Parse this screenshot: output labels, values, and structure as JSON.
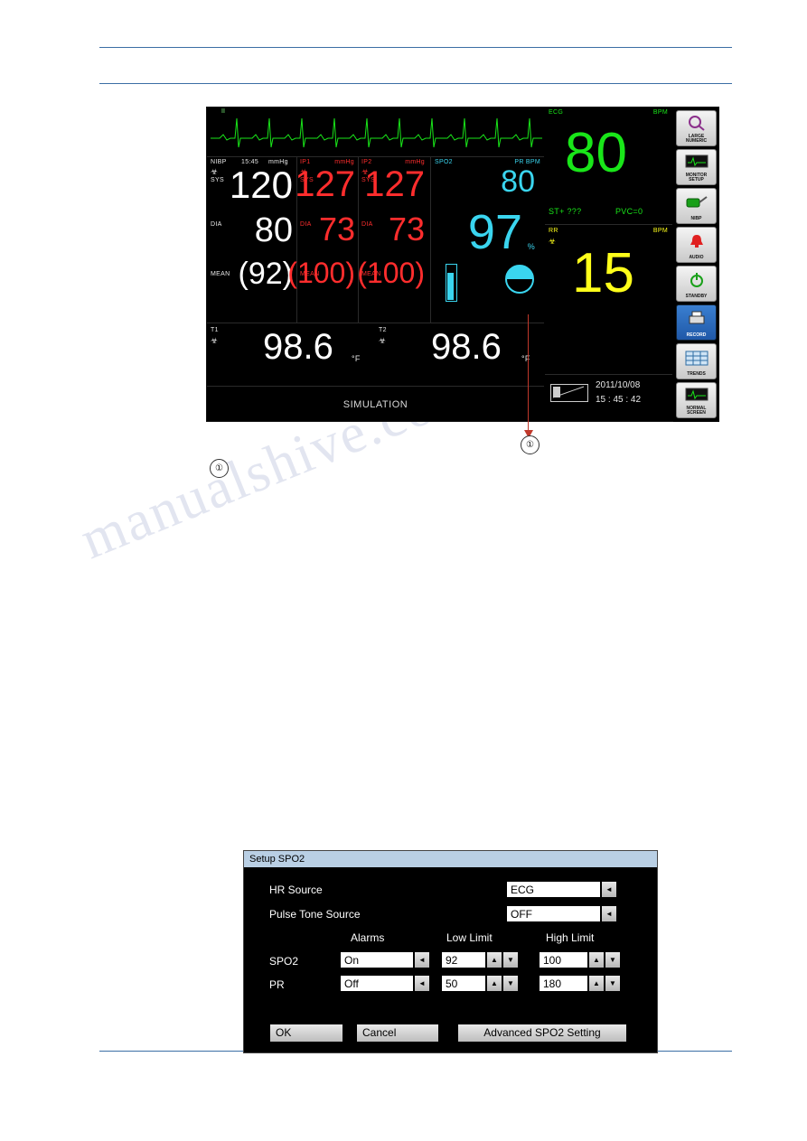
{
  "monitor": {
    "wave": {
      "lead_label": "II"
    },
    "nibp": {
      "title": "NIBP",
      "time": "15:45",
      "unit": "mmHg",
      "sys_label": "SYS",
      "dia_label": "DIA",
      "mean_label": "MEAN",
      "sys": "120",
      "dia": "80",
      "mean": "(92)"
    },
    "ibp1": {
      "title": "IP1",
      "unit": "mmHg",
      "sys_label": "SYS",
      "dia_label": "DIA",
      "mean_label": "MEAN",
      "sys": "127",
      "dia": "73",
      "mean": "(100)"
    },
    "ibp2": {
      "title": "IP2",
      "unit": "mmHg",
      "sys_label": "SYS",
      "dia_label": "DIA",
      "mean_label": "MEAN",
      "sys": "127",
      "dia": "73",
      "mean": "(100)"
    },
    "spo2": {
      "title": "SPO2",
      "pr_label": "PR BPM",
      "pr_value": "80",
      "spo2_value": "97",
      "percent": "%"
    },
    "temps": {
      "t1_label": "T1",
      "t1_value": "98.6",
      "t1_unit": "°F",
      "t2_label": "T2",
      "t2_value": "98.6",
      "t2_unit": "°F"
    },
    "status_bar": "SIMULATION",
    "hr": {
      "title": "ECG",
      "unit": "BPM",
      "value": "80",
      "st": "ST+ ???",
      "pvc": "PVC=0"
    },
    "rr": {
      "title": "RR",
      "unit": "BPM",
      "value": "15"
    },
    "datetime": {
      "date": "2011/10/08",
      "time": "15 : 45 : 42"
    },
    "softkeys": [
      {
        "name": "large-numeric",
        "label": "LARGE\nNUMERIC",
        "icon": "magnifier-icon"
      },
      {
        "name": "monitor-setup",
        "label": "MONITOR\nSETUP",
        "icon": "monitor-icon"
      },
      {
        "name": "nibp",
        "label": "NIBP",
        "icon": "cuff-icon"
      },
      {
        "name": "audio",
        "label": "AUDIO",
        "icon": "bell-icon"
      },
      {
        "name": "standby",
        "label": "STANDBY",
        "icon": "power-icon"
      },
      {
        "name": "record",
        "label": "RECORD",
        "icon": "printer-icon"
      },
      {
        "name": "trends",
        "label": "TRENDS",
        "icon": "table-icon"
      },
      {
        "name": "normal-screen",
        "label": "NORMAL\nSCREEN",
        "icon": "waveform-icon"
      }
    ]
  },
  "callouts": {
    "one": "①",
    "one_left": "①"
  },
  "watermark": "manualshive.com",
  "dialog": {
    "title": "Setup SPO2",
    "hr_source_label": "HR Source",
    "hr_source_value": "ECG",
    "pulse_tone_label": "Pulse Tone Source",
    "pulse_tone_value": "OFF",
    "col_alarms": "Alarms",
    "col_low": "Low Limit",
    "col_high": "High Limit",
    "rows": [
      {
        "name": "SPO2",
        "alarm": "On",
        "low": "92",
        "high": "100"
      },
      {
        "name": "PR",
        "alarm": "Off",
        "low": "50",
        "high": "180"
      }
    ],
    "ok": "OK",
    "cancel": "Cancel",
    "advanced": "Advanced SPO2 Setting",
    "arrow_left": "◄",
    "arrow_up": "▲",
    "arrow_down": "▼"
  },
  "colors": {
    "rule": "#3b6ea5",
    "green": "#19e619",
    "red": "#ff2d2d",
    "cyan": "#3ad5ef",
    "yellow": "#ffff1a",
    "white": "#ffffff",
    "callout": "#c0392b"
  }
}
